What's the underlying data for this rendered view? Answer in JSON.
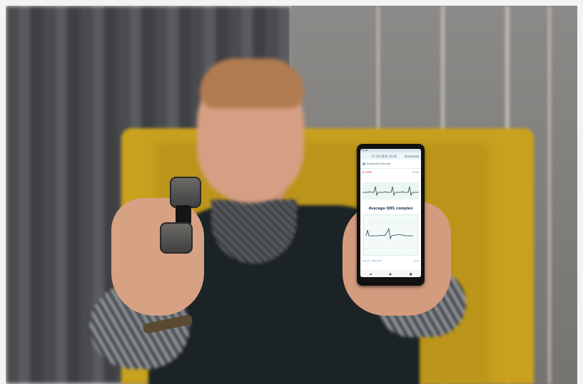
{
  "scene": {
    "description_objects": [
      "man",
      "ecg-device",
      "smartphone",
      "yellow-chair"
    ]
  },
  "phone_screen": {
    "status_time": "12:02",
    "header_date": "17.10.2022",
    "header_time": "10:32",
    "header_action": "Download",
    "device_label": "Bardiarotti Monitor",
    "hr_label": "67 BPM",
    "hr_value": "17:00",
    "qrs_title": "Average QRS complex",
    "footer_left": "Alarms · Standard",
    "footer_right": "Load",
    "nav_back": "◀",
    "nav_home": "●",
    "nav_recent": "■",
    "colors": {
      "ecg_line": "#2c3e50",
      "grid": "#9fd0c4",
      "accent": "#c0392b"
    }
  }
}
